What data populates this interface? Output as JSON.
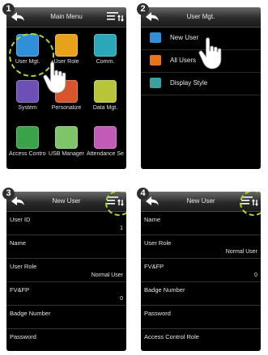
{
  "steps": [
    "1",
    "2",
    "3",
    "4"
  ],
  "panel1": {
    "title": "Main Menu",
    "tiles": [
      {
        "label": "User Mgt.",
        "color": "#2f8fd8",
        "icon": "user-mgt-icon"
      },
      {
        "label": "User Role",
        "color": "#e7a21a",
        "icon": "user-role-icon"
      },
      {
        "label": "Comm.",
        "color": "#2aa7b8",
        "icon": "comm-icon"
      },
      {
        "label": "System",
        "color": "#6d4fb5",
        "icon": "system-icon"
      },
      {
        "label": "Personalize",
        "color": "#d9542a",
        "icon": "personalize-icon"
      },
      {
        "label": "Data Mgt.",
        "color": "#b8c43a",
        "icon": "data-mgt-icon"
      },
      {
        "label": "Access Control",
        "color": "#3aa24a",
        "icon": "access-control-icon"
      },
      {
        "label": "USB Manager",
        "color": "#7fc36a",
        "icon": "usb-manager-icon"
      },
      {
        "label": "Attendance Search",
        "color": "#c25ab8",
        "icon": "attendance-search-icon"
      }
    ]
  },
  "panel2": {
    "title": "User Mgt.",
    "items": [
      {
        "label": "New User",
        "color": "#2f8fd8"
      },
      {
        "label": "All Users",
        "color": "#e7761a"
      },
      {
        "label": "Display Style",
        "color": "#3aa0a0"
      }
    ]
  },
  "panel3": {
    "title": "New User",
    "fields": [
      {
        "key": "User ID",
        "value": "1"
      },
      {
        "key": "Name",
        "value": ""
      },
      {
        "key": "User Role",
        "value": "Normal User"
      },
      {
        "key": "FV&FP",
        "value": "0"
      },
      {
        "key": "Badge Number",
        "value": ""
      },
      {
        "key": "Password",
        "value": ""
      }
    ]
  },
  "panel4": {
    "title": "New User",
    "fields": [
      {
        "key": "Name",
        "value": ""
      },
      {
        "key": "User Role",
        "value": "Normal User"
      },
      {
        "key": "FV&FP",
        "value": "0"
      },
      {
        "key": "Badge Number",
        "value": ""
      },
      {
        "key": "Password",
        "value": ""
      },
      {
        "key": "Access Control Role",
        "value": ""
      }
    ]
  }
}
